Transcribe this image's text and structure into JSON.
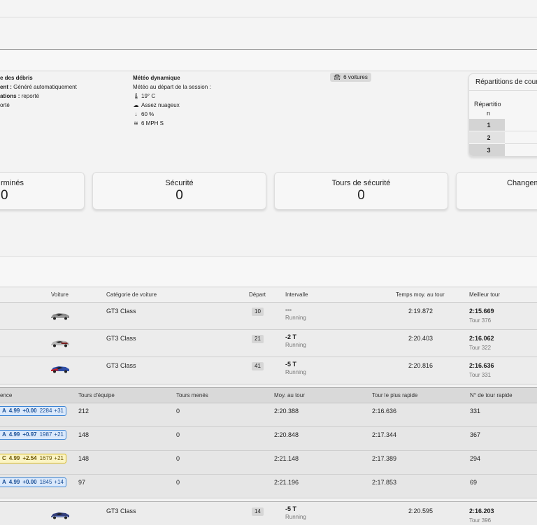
{
  "info": {
    "debris": {
      "title": "e des débris",
      "line1_label": "ent :",
      "line1_value": "Généré automatiquement",
      "line2_label": "ations :",
      "line2_value": "reporté",
      "line3": "orté"
    },
    "weather": {
      "title": "Météo dynamique",
      "subtitle": "Météo au départ de la session :",
      "temperature": "19° C",
      "sky": "Assez nuageux",
      "humidity": "60 %",
      "wind": "6 MPH S"
    },
    "cars_badge": "6 voitures",
    "distribution": {
      "title": "Répartitions de cours",
      "subtitle": "Répartitio",
      "col": "n",
      "rows": [
        "1",
        "2",
        "3"
      ]
    }
  },
  "stats": [
    {
      "title": "rminés",
      "value": "0"
    },
    {
      "title": "Sécurité",
      "value": "0"
    },
    {
      "title": "Tours de sécurité",
      "value": "0"
    },
    {
      "title": "Changem",
      "value": ""
    }
  ],
  "cars_table": {
    "headers": {
      "car": "Voiture",
      "category": "Catégorie de voiture",
      "start": "Départ",
      "interval": "Intervalle",
      "avg": "Temps moy. au tour",
      "best": "Meilleur tour"
    },
    "rows": [
      {
        "category": "GT3 Class",
        "start": "10",
        "interval": "---",
        "status": "Running",
        "avg": "2:19.872",
        "best": "2:15.669",
        "best_lap": "Tour 376"
      },
      {
        "category": "GT3 Class",
        "start": "21",
        "interval": "-2 T",
        "status": "Running",
        "avg": "2:20.403",
        "best": "2:16.062",
        "best_lap": "Tour 322"
      },
      {
        "category": "GT3 Class",
        "start": "41",
        "interval": "-5 T",
        "status": "Running",
        "avg": "2:20.816",
        "best": "2:16.636",
        "best_lap": "Tour 331"
      }
    ],
    "last_row": {
      "category": "GT3 Class",
      "start": "14",
      "interval": "-5 T",
      "status": "Running",
      "avg": "2:20.595",
      "best": "2:16.203",
      "best_lap": "Tour 396"
    }
  },
  "drivers_table": {
    "headers": {
      "licence": "ence",
      "team_laps": "Tours d'équipe",
      "laps_led": "Tours menés",
      "avg": "Moy. au tour",
      "fastest": "Tour le plus rapide",
      "fastest_no": "N° de tour rapide"
    },
    "rows": [
      {
        "class": "A",
        "sr": "4.99",
        "sr_delta": "+0.00",
        "ir": "2284",
        "ir_delta": "+31",
        "team_laps": "212",
        "laps_led": "0",
        "avg": "2:20.388",
        "fastest": "2:16.636",
        "fastest_no": "331"
      },
      {
        "class": "A",
        "sr": "4.99",
        "sr_delta": "+0.97",
        "ir": "1987",
        "ir_delta": "+21",
        "team_laps": "148",
        "laps_led": "0",
        "avg": "2:20.848",
        "fastest": "2:17.344",
        "fastest_no": "367"
      },
      {
        "class": "C",
        "sr": "4.99",
        "sr_delta": "+2.54",
        "ir": "1679",
        "ir_delta": "+21",
        "team_laps": "148",
        "laps_led": "0",
        "avg": "2:21.148",
        "fastest": "2:17.389",
        "fastest_no": "294"
      },
      {
        "class": "A",
        "sr": "4.99",
        "sr_delta": "+0.00",
        "ir": "1845",
        "ir_delta": "+14",
        "team_laps": "97",
        "laps_led": "0",
        "avg": "2:21.196",
        "fastest": "2:17.853",
        "fastest_no": "69"
      }
    ]
  },
  "colors": {
    "licence_a_bg": "#dbe9fb",
    "licence_a_border": "#3d86d6",
    "licence_a_text": "#1a4f96",
    "licence_c_bg": "#fbf4c4",
    "licence_c_border": "#d8b81b",
    "licence_c_text": "#6a5400"
  }
}
